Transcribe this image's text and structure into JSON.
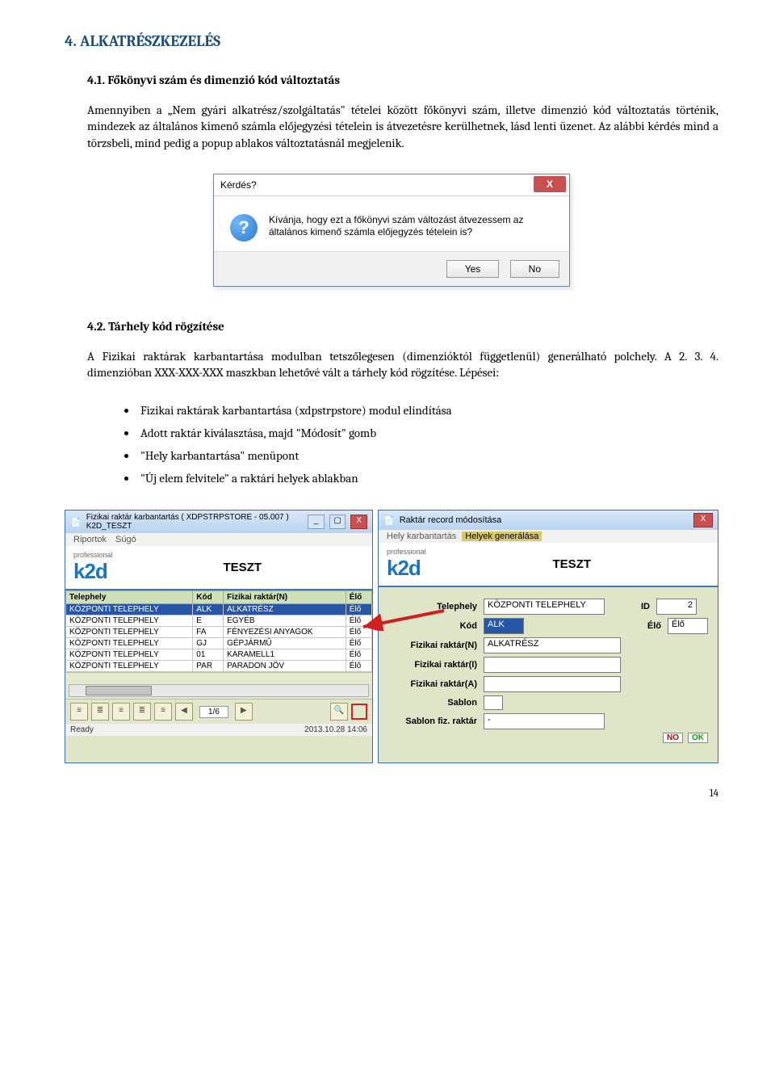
{
  "h2": "4. ALKATRÉSZKEZELÉS",
  "s41": {
    "title": "4.1. Főkönyvi szám és dimenzió kód változtatás",
    "p": "Amennyiben a „Nem gyári alkatrész/szolgáltatás\" tételei között főkönyvi szám, illetve dimenzió kód változtatás történik, mindezek az általános kimenő számla előjegyzési tételein is átvezetésre kerülhetnek, lásd lenti üzenet. Az alábbi kérdés mind a törzsbeli, mind pedig a popup ablakos változtatásnál megjelenik."
  },
  "dialog": {
    "title": "Kérdés?",
    "msg": "Kívánja, hogy ezt a főkönyvi szám változást átvezessem az általános kimenő számla előjegyzés tételein is?",
    "yes": "Yes",
    "no": "No",
    "x": "X"
  },
  "s42": {
    "title": "4.2. Tárhely kód rögzítése",
    "p": "A Fizikai raktárak karbantartása modulban tetszőlegesen (dimenzióktól függetlenül) generálható polchely. A 2. 3. 4. dimenzióban XXX-XXX-XXX maszkban lehetővé vált a tárhely kód rögzítése. Lépései:",
    "b1": "Fizikai raktárak karbantartása (xdpstrpstore) modul elindítása",
    "b2": "Adott raktár kiválasztása, majd \"Módosít\" gomb",
    "b3": "\"Hely karbantartása\" menüpont",
    "b4": "\"Új elem felvitele\" a raktári helyek ablakban"
  },
  "app": {
    "leftTitle": "Fizikai raktár karbantartás ( XDPSTRPSTORE - 05.007 )    K2D_TESZT",
    "menuReports": "Riportok",
    "menuHelp": "Súgó",
    "brand": "k2d",
    "brandSub": "professional",
    "teszt": "TESZT",
    "cols": [
      "Telephely",
      "Kód",
      "Fizikai raktár(N)",
      "Élő"
    ],
    "rows": [
      [
        "KÖZPONTI TELEPHELY",
        "ALK",
        "ALKATRÉSZ",
        "Élő"
      ],
      [
        "KÖZPONTI TELEPHELY",
        "E",
        "EGYÉB",
        "Élő"
      ],
      [
        "KÖZPONTI TELEPHELY",
        "FA",
        "FÉNYEZÉSI ANYAGOK",
        "Élő"
      ],
      [
        "KÖZPONTI TELEPHELY",
        "GJ",
        "GÉPJÁRMŰ",
        "Élő"
      ],
      [
        "KÖZPONTI TELEPHELY",
        "01",
        "KARAMELL1",
        "Élő"
      ],
      [
        "KÖZPONTI TELEPHELY",
        "PAR",
        "PARADON JÖV",
        "Élő"
      ]
    ],
    "pager": "1/6",
    "ready": "Ready",
    "time": "2013.10.28 14:06",
    "rightTitle": "Raktár record módosítása",
    "rightMenu1": "Hely karbantartás",
    "rightMenu2": "Helyek generálása",
    "form": {
      "telephely": {
        "label": "Telephely",
        "value": "KÖZPONTI TELEPHELY"
      },
      "id": {
        "label": "ID",
        "value": "2"
      },
      "kod": {
        "label": "Kód",
        "value": "ALK"
      },
      "elo": {
        "label": "Élő",
        "value": "Élő"
      },
      "raktN": {
        "label": "Fizikai raktár(N)",
        "value": "ALKATRÉSZ"
      },
      "raktI": {
        "label": "Fizikai raktár(I)",
        "value": ""
      },
      "raktA": {
        "label": "Fizikai raktár(A)",
        "value": ""
      },
      "sablon": {
        "label": "Sablon"
      },
      "sablonR": {
        "label": "Sablon fiz. raktár",
        "value": "-"
      },
      "no": "NO",
      "ok": "OK"
    }
  },
  "pagenum": "14"
}
